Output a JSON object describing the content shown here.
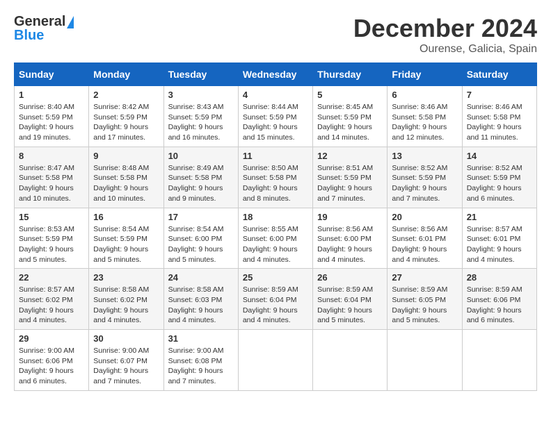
{
  "header": {
    "logo_line1": "General",
    "logo_line2": "Blue",
    "month": "December 2024",
    "location": "Ourense, Galicia, Spain"
  },
  "weekdays": [
    "Sunday",
    "Monday",
    "Tuesday",
    "Wednesday",
    "Thursday",
    "Friday",
    "Saturday"
  ],
  "weeks": [
    [
      {
        "day": "1",
        "info": "Sunrise: 8:40 AM\nSunset: 5:59 PM\nDaylight: 9 hours and 19 minutes."
      },
      {
        "day": "2",
        "info": "Sunrise: 8:42 AM\nSunset: 5:59 PM\nDaylight: 9 hours and 17 minutes."
      },
      {
        "day": "3",
        "info": "Sunrise: 8:43 AM\nSunset: 5:59 PM\nDaylight: 9 hours and 16 minutes."
      },
      {
        "day": "4",
        "info": "Sunrise: 8:44 AM\nSunset: 5:59 PM\nDaylight: 9 hours and 15 minutes."
      },
      {
        "day": "5",
        "info": "Sunrise: 8:45 AM\nSunset: 5:59 PM\nDaylight: 9 hours and 14 minutes."
      },
      {
        "day": "6",
        "info": "Sunrise: 8:46 AM\nSunset: 5:58 PM\nDaylight: 9 hours and 12 minutes."
      },
      {
        "day": "7",
        "info": "Sunrise: 8:46 AM\nSunset: 5:58 PM\nDaylight: 9 hours and 11 minutes."
      }
    ],
    [
      {
        "day": "8",
        "info": "Sunrise: 8:47 AM\nSunset: 5:58 PM\nDaylight: 9 hours and 10 minutes."
      },
      {
        "day": "9",
        "info": "Sunrise: 8:48 AM\nSunset: 5:58 PM\nDaylight: 9 hours and 10 minutes."
      },
      {
        "day": "10",
        "info": "Sunrise: 8:49 AM\nSunset: 5:58 PM\nDaylight: 9 hours and 9 minutes."
      },
      {
        "day": "11",
        "info": "Sunrise: 8:50 AM\nSunset: 5:58 PM\nDaylight: 9 hours and 8 minutes."
      },
      {
        "day": "12",
        "info": "Sunrise: 8:51 AM\nSunset: 5:59 PM\nDaylight: 9 hours and 7 minutes."
      },
      {
        "day": "13",
        "info": "Sunrise: 8:52 AM\nSunset: 5:59 PM\nDaylight: 9 hours and 7 minutes."
      },
      {
        "day": "14",
        "info": "Sunrise: 8:52 AM\nSunset: 5:59 PM\nDaylight: 9 hours and 6 minutes."
      }
    ],
    [
      {
        "day": "15",
        "info": "Sunrise: 8:53 AM\nSunset: 5:59 PM\nDaylight: 9 hours and 5 minutes."
      },
      {
        "day": "16",
        "info": "Sunrise: 8:54 AM\nSunset: 5:59 PM\nDaylight: 9 hours and 5 minutes."
      },
      {
        "day": "17",
        "info": "Sunrise: 8:54 AM\nSunset: 6:00 PM\nDaylight: 9 hours and 5 minutes."
      },
      {
        "day": "18",
        "info": "Sunrise: 8:55 AM\nSunset: 6:00 PM\nDaylight: 9 hours and 4 minutes."
      },
      {
        "day": "19",
        "info": "Sunrise: 8:56 AM\nSunset: 6:00 PM\nDaylight: 9 hours and 4 minutes."
      },
      {
        "day": "20",
        "info": "Sunrise: 8:56 AM\nSunset: 6:01 PM\nDaylight: 9 hours and 4 minutes."
      },
      {
        "day": "21",
        "info": "Sunrise: 8:57 AM\nSunset: 6:01 PM\nDaylight: 9 hours and 4 minutes."
      }
    ],
    [
      {
        "day": "22",
        "info": "Sunrise: 8:57 AM\nSunset: 6:02 PM\nDaylight: 9 hours and 4 minutes."
      },
      {
        "day": "23",
        "info": "Sunrise: 8:58 AM\nSunset: 6:02 PM\nDaylight: 9 hours and 4 minutes."
      },
      {
        "day": "24",
        "info": "Sunrise: 8:58 AM\nSunset: 6:03 PM\nDaylight: 9 hours and 4 minutes."
      },
      {
        "day": "25",
        "info": "Sunrise: 8:59 AM\nSunset: 6:04 PM\nDaylight: 9 hours and 4 minutes."
      },
      {
        "day": "26",
        "info": "Sunrise: 8:59 AM\nSunset: 6:04 PM\nDaylight: 9 hours and 5 minutes."
      },
      {
        "day": "27",
        "info": "Sunrise: 8:59 AM\nSunset: 6:05 PM\nDaylight: 9 hours and 5 minutes."
      },
      {
        "day": "28",
        "info": "Sunrise: 8:59 AM\nSunset: 6:06 PM\nDaylight: 9 hours and 6 minutes."
      }
    ],
    [
      {
        "day": "29",
        "info": "Sunrise: 9:00 AM\nSunset: 6:06 PM\nDaylight: 9 hours and 6 minutes."
      },
      {
        "day": "30",
        "info": "Sunrise: 9:00 AM\nSunset: 6:07 PM\nDaylight: 9 hours and 7 minutes."
      },
      {
        "day": "31",
        "info": "Sunrise: 9:00 AM\nSunset: 6:08 PM\nDaylight: 9 hours and 7 minutes."
      },
      null,
      null,
      null,
      null
    ]
  ]
}
